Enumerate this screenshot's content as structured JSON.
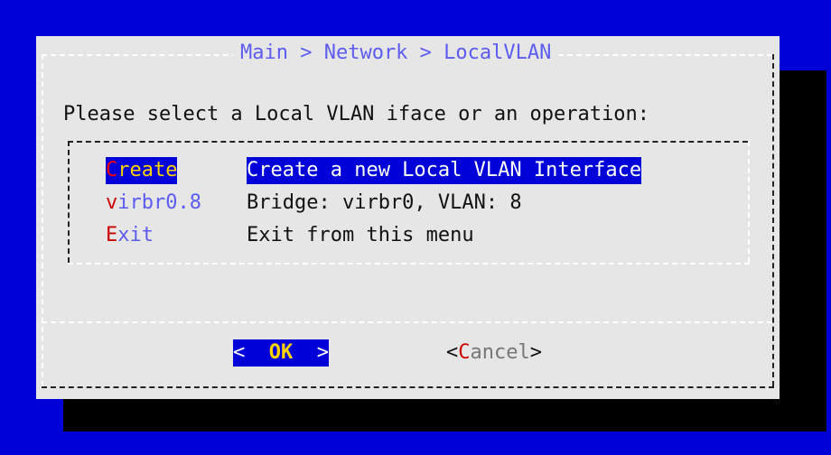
{
  "dialog": {
    "title": "Main > Network > LocalVLAN",
    "prompt": "Please select a Local VLAN iface or an operation:"
  },
  "menu": {
    "items": [
      {
        "tag_hot": "C",
        "tag_rest": "reate",
        "description": "Create a new Local VLAN Interface",
        "selected": true
      },
      {
        "tag_hot": "v",
        "tag_rest": "irbr0.8",
        "description": "Bridge: virbr0, VLAN: 8",
        "selected": false
      },
      {
        "tag_hot": "E",
        "tag_rest": "xit",
        "description": "Exit from this menu",
        "selected": false
      }
    ]
  },
  "buttons": {
    "ok_left": "<  ",
    "ok_label": "OK",
    "ok_right": "  >",
    "cancel_open": "<",
    "cancel_hot": "C",
    "cancel_rest": "ancel",
    "cancel_close": ">"
  },
  "colors": {
    "screen_background": "#0000d8",
    "dialog_background": "#e6e6e6",
    "title_text": "#5c5cf0",
    "hotkey": "#cc0000",
    "selected_background": "#0000d8",
    "selected_tag_text": "#ffd400"
  }
}
